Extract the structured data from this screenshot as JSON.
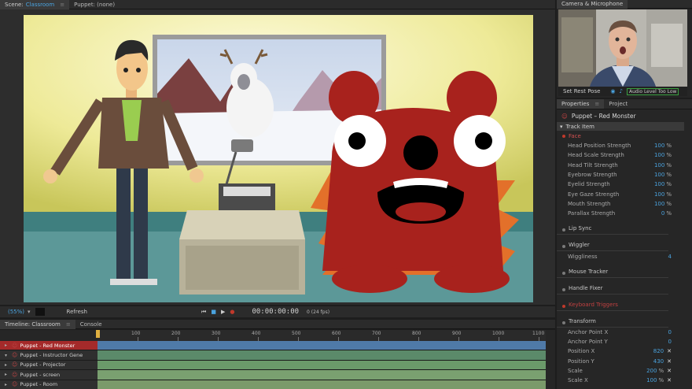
{
  "scene_panel": {
    "tab_label": "Scene:",
    "scene_name": "Classroom",
    "puppet_tab_label": "Puppet: (none)"
  },
  "transport": {
    "zoom": "(55%)",
    "refresh_label": "Refresh",
    "timecode": "00:00:00:00",
    "fps": "0 (24 fps)"
  },
  "timeline": {
    "tab_label": "Timeline: Classroom",
    "console_label": "Console",
    "ruler_ticks": [
      "100",
      "200",
      "300",
      "400",
      "500",
      "600",
      "700",
      "800",
      "900",
      "1000",
      "1100"
    ],
    "tracks": [
      {
        "label": "Puppet - Red Monster",
        "selected": true,
        "expanded": false
      },
      {
        "label": "Puppet - Instructor Gene",
        "selected": false,
        "expanded": true
      },
      {
        "label": "Puppet - Projector",
        "selected": false,
        "expanded": false
      },
      {
        "label": "Puppet - screen",
        "selected": false,
        "expanded": false
      },
      {
        "label": "Puppet - Room",
        "selected": false,
        "expanded": false
      }
    ]
  },
  "camera_panel": {
    "tab_label": "Camera & Microphone",
    "set_rest_pose": "Set Rest Pose",
    "audio_status": "Audio Level Too Low"
  },
  "properties": {
    "tab_label": "Properties",
    "project_tab": "Project",
    "puppet_title": "Puppet – Red Monster",
    "track_item": "Track Item",
    "face_section": "Face",
    "face_params": [
      {
        "label": "Head Position Strength",
        "value": "100",
        "unit": "%"
      },
      {
        "label": "Head Scale Strength",
        "value": "100",
        "unit": "%"
      },
      {
        "label": "Head Tilt Strength",
        "value": "100",
        "unit": "%"
      },
      {
        "label": "Eyebrow Strength",
        "value": "100",
        "unit": "%"
      },
      {
        "label": "Eyelid Strength",
        "value": "100",
        "unit": "%"
      },
      {
        "label": "Eye Gaze Strength",
        "value": "100",
        "unit": "%"
      },
      {
        "label": "Mouth Strength",
        "value": "100",
        "unit": "%"
      },
      {
        "label": "Parallax Strength",
        "value": "0",
        "unit": "%"
      }
    ],
    "lip_sync": "Lip Sync",
    "wiggler": "Wiggler",
    "wiggliness_label": "Wiggliness",
    "wiggliness_value": "4",
    "mouse_tracker": "Mouse Tracker",
    "handle_fixer": "Handle Fixer",
    "keyboard_triggers": "Keyboard Triggers",
    "transform": "Transform",
    "transform_params": [
      {
        "label": "Anchor Point X",
        "value": "0",
        "unit": "",
        "x": false
      },
      {
        "label": "Anchor Point Y",
        "value": "0",
        "unit": "",
        "x": false
      },
      {
        "label": "Position X",
        "value": "820",
        "unit": "",
        "x": true
      },
      {
        "label": "Position Y",
        "value": "430",
        "unit": "",
        "x": true
      },
      {
        "label": "Scale",
        "value": "200",
        "unit": "%",
        "x": true
      },
      {
        "label": "Scale X",
        "value": "100",
        "unit": "%",
        "x": true
      }
    ]
  },
  "colors": {
    "accent": "#4aa3df",
    "selected_track": "#a52a2a",
    "monster": "#a8221d"
  }
}
